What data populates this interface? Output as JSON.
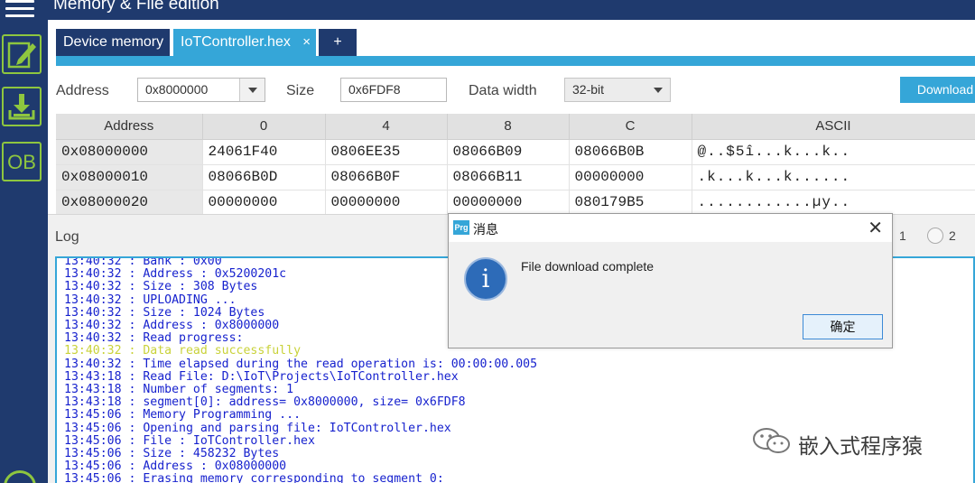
{
  "app": {
    "title": "Memory & File edition"
  },
  "sidebar": {
    "items": [
      {
        "name": "menu-icon"
      },
      {
        "name": "edit-icon"
      },
      {
        "name": "download-icon"
      },
      {
        "name": "option-bytes",
        "label": "OB"
      }
    ],
    "accent": "#8ec63f",
    "background": "#1f3a6e"
  },
  "tabs": {
    "items": [
      {
        "label": "Device memory"
      },
      {
        "label": "IoTController.hex",
        "close": "×"
      },
      {
        "label": "+"
      }
    ],
    "active_color": "#35a6d8"
  },
  "toolbar": {
    "address_label": "Address",
    "address_value": "0x8000000",
    "size_label": "Size",
    "size_value": "0x6FDF8",
    "data_width_label": "Data width",
    "data_width_value": "32-bit",
    "download_label": "Download"
  },
  "memory_table": {
    "columns": [
      "Address",
      "0",
      "4",
      "8",
      "C",
      "ASCII"
    ],
    "rows": [
      [
        "0x08000000",
        "24061F40",
        "0806EE35",
        "08066B09",
        "08066B0B",
        "@..$5î...k...k.."
      ],
      [
        "0x08000010",
        "08066B0D",
        "08066B0F",
        "08066B11",
        "00000000",
        ".k...k...k......"
      ],
      [
        "0x08000020",
        "00000000",
        "00000000",
        "00000000",
        "080179B5",
        "............µy.."
      ]
    ]
  },
  "log": {
    "title": "Log",
    "radio_labels": [
      "1",
      "2"
    ],
    "lines": [
      {
        "time": "13:40:32",
        "text": "Bank : 0x00"
      },
      {
        "time": "13:40:32",
        "text": "Address : 0x5200201c"
      },
      {
        "time": "13:40:32",
        "text": "Size : 308 Bytes"
      },
      {
        "time": "13:40:32",
        "text": "UPLOADING ..."
      },
      {
        "time": "13:40:32",
        "text": "Size : 1024 Bytes"
      },
      {
        "time": "13:40:32",
        "text": "Address : 0x8000000"
      },
      {
        "time": "13:40:32",
        "text": "Read progress:"
      },
      {
        "time": "13:40:32",
        "text": "Data read successfully",
        "status": "success"
      },
      {
        "time": "13:40:32",
        "text": "Time elapsed during the read operation is: 00:00:00.005"
      },
      {
        "time": "13:43:18",
        "text": "Read File: D:\\IoT\\Projects\\IoTController.hex"
      },
      {
        "time": "13:43:18",
        "text": "Number of segments: 1"
      },
      {
        "time": "13:43:18",
        "text": "segment[0]: address= 0x8000000, size= 0x6FDF8"
      },
      {
        "time": "13:45:06",
        "text": "Memory Programming ..."
      },
      {
        "time": "13:45:06",
        "text": "Opening and parsing file: IoTController.hex"
      },
      {
        "time": "13:45:06",
        "text": "File : IoTController.hex"
      },
      {
        "time": "13:45:06",
        "text": "Size : 458232 Bytes"
      },
      {
        "time": "13:45:06",
        "text": "Address : 0x08000000"
      },
      {
        "time": "13:45:06",
        "text": "Erasing memory corresponding to segment 0:"
      }
    ],
    "text_color": "#1722ce",
    "success_color": "#c9d23a"
  },
  "dialog": {
    "app_icon": "Prg",
    "title": "消息",
    "close": "✕",
    "message": "File download complete",
    "icon": "info-icon",
    "ok_label": "确定"
  },
  "watermark": {
    "text": "嵌入式程序猿"
  }
}
